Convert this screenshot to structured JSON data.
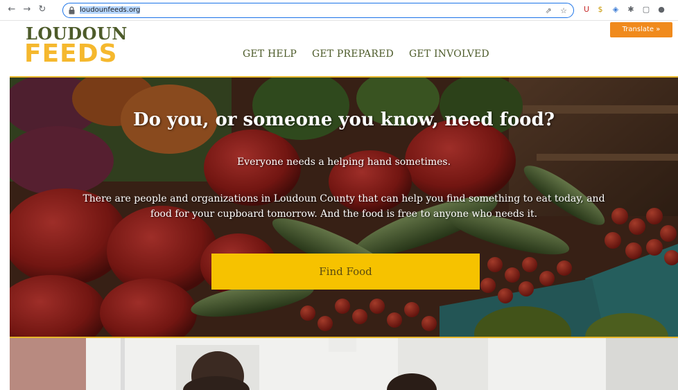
{
  "browser": {
    "url": "loudounfeeds.org",
    "back_icon": "arrow-left-icon",
    "forward_icon": "arrow-right-icon",
    "reload_icon": "reload-icon"
  },
  "site": {
    "logo_line1": "LOUDOUN",
    "logo_line2": "FEEDS",
    "nav": [
      "GET HELP",
      "GET PREPARED",
      "GET INVOLVED"
    ],
    "translate_label": "Translate »"
  },
  "hero": {
    "title": "Do you, or someone you know, need food?",
    "subtitle": "Everyone needs a helping hand sometimes.",
    "body": "There are people and organizations in Loudoun County that can help you find something to eat today, and food for your cupboard tomorrow. And the food is free to anyone who needs it.",
    "cta_label": "Find Food"
  },
  "colors": {
    "logo_green": "#4d5b2a",
    "logo_gold": "#f5b82e",
    "translate_orange": "#f08a1c",
    "cta_yellow": "#f6c200",
    "hero_border": "#e6b62a"
  }
}
